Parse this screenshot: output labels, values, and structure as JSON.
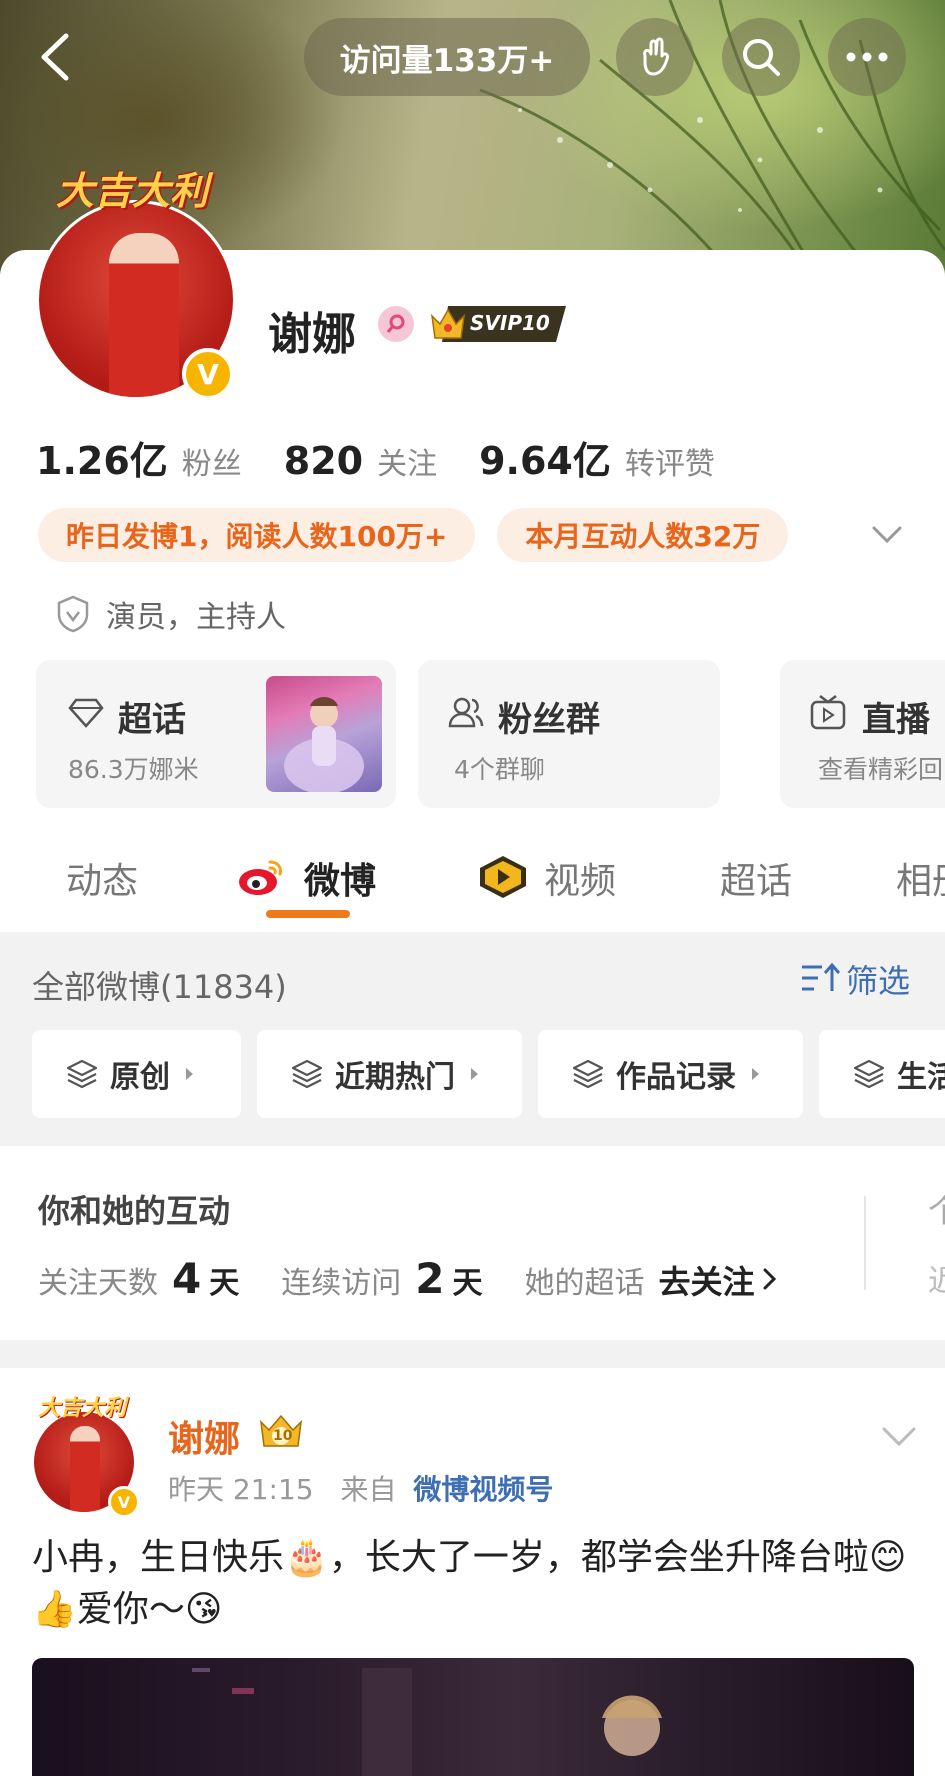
{
  "header": {
    "visits_label": "访问量133万+"
  },
  "profile": {
    "avatar_topper": "大吉大利",
    "verified_badge": "V",
    "name": "谢娜",
    "svip_label": "SVIP10",
    "stats": [
      {
        "value": "1.26亿",
        "label": "粉丝"
      },
      {
        "value": "820",
        "label": "关注"
      },
      {
        "value": "9.64亿",
        "label": "转评赞"
      }
    ],
    "tags": [
      "昨日发博1，阅读人数100万+",
      "本月互动人数32万"
    ],
    "identity": "演员，主持人"
  },
  "features": [
    {
      "title": "超话",
      "sub": "86.3万娜米"
    },
    {
      "title": "粉丝群",
      "sub": "4个群聊"
    },
    {
      "title": "直播",
      "sub": "查看精彩回"
    }
  ],
  "tabs": [
    {
      "label": "动态"
    },
    {
      "label": "微博"
    },
    {
      "label": "视频"
    },
    {
      "label": "超话"
    },
    {
      "label": "相册"
    }
  ],
  "feed": {
    "all_count_label": "全部微博(11834)",
    "filter_label": "筛选",
    "chips": [
      "原创",
      "近期热门",
      "作品记录",
      "生活"
    ]
  },
  "interaction": {
    "title": "你和她的互动",
    "follow_days_label": "关注天数",
    "follow_days_value": "4",
    "day_unit": "天",
    "visit_streak_label": "连续访问",
    "visit_streak_value": "2",
    "supertopic_label": "她的超话",
    "supertopic_action": "去关注",
    "peek_title": "个",
    "peek_sub": "近"
  },
  "post": {
    "author": "谢娜",
    "crown_level": "10",
    "time": "昨天 21:15",
    "source_prefix": "来自",
    "source": "微博视频号",
    "text": "小冉，生日快乐🎂，长大了一岁，都学会坐升降台啦😊👍爱你～😘"
  },
  "colors": {
    "accent_orange": "#ef7a1b",
    "link_blue": "#3f6fb3",
    "tag_bg": "#fdeee4"
  },
  "icons": [
    "back-arrow-icon",
    "wave-hand-icon",
    "search-icon",
    "more-icon",
    "female-icon",
    "crown-icon",
    "shield-icon",
    "diamond-icon",
    "group-icon",
    "tv-icon",
    "weibo-logo-icon",
    "video-play-icon",
    "filter-icon",
    "layers-icon",
    "chevron-down-icon",
    "chevron-right-icon"
  ]
}
